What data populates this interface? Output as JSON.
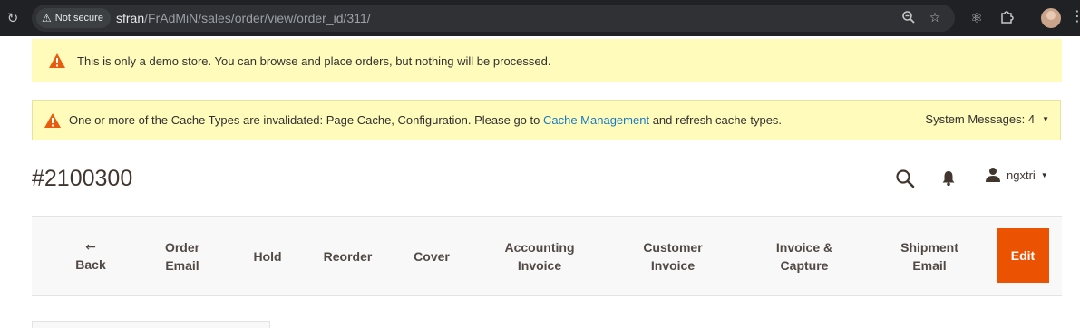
{
  "browser": {
    "security_label": "Not secure",
    "url_host": "sfran",
    "url_path": "/FrAdMiN/sales/order/view/order_id/311/",
    "icons": [
      "reload-icon",
      "warning-icon",
      "zoom-icon",
      "star-icon",
      "extension-puzzle-icon",
      "react-devtools-icon",
      "profile-avatar",
      "more-icon"
    ]
  },
  "notices": {
    "demo_text": "This is only a demo store. You can browse and place orders, but nothing will be processed.",
    "cache_text_before": "One or more of the Cache Types are invalidated: Page Cache, Configuration. Please go to",
    "cache_link": "Cache Management",
    "cache_text_after": "and refresh cache types.",
    "system_messages": "System Messages: 4"
  },
  "header": {
    "title": "#2100300",
    "username": "ngxtri"
  },
  "toolbar": {
    "back": "Back",
    "order_email_1": "Order",
    "order_email_2": "Email",
    "hold": "Hold",
    "reorder": "Reorder",
    "cover": "Cover",
    "accounting_1": "Accounting",
    "accounting_2": "Invoice",
    "customer_1": "Customer",
    "customer_2": "Invoice",
    "invcap_1": "Invoice &",
    "invcap_2": "Capture",
    "ship_1": "Shipment",
    "ship_2": "Email",
    "edit": "Edit"
  },
  "colors": {
    "accent": "#eb5202",
    "notice_bg": "#fffbbb",
    "link": "#1979c3",
    "warning": "#e22626"
  }
}
